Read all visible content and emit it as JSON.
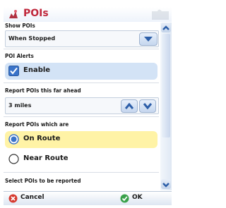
{
  "window": {
    "title": "POIs"
  },
  "show_pois": {
    "label": "Show POIs",
    "value": "When Stopped"
  },
  "poi_alerts": {
    "label": "POI Alerts",
    "checkbox_label": "Enable",
    "checked": true
  },
  "report_ahead": {
    "label": "Report POIs this far ahead",
    "value": "3 miles"
  },
  "report_which": {
    "label": "Report POIs which are",
    "options": [
      {
        "label": "On Route",
        "selected": true
      },
      {
        "label": "Near Route",
        "selected": false
      }
    ]
  },
  "select_pois": {
    "label": "Select POIs to be reported"
  },
  "buttons": {
    "cancel": "Cancel",
    "ok": "OK"
  },
  "colors": {
    "title": "#c0283c",
    "highlight_blue": "#d3e3f6",
    "highlight_yellow": "#fff3a6",
    "accent_blue": "#3a73c9",
    "accent_green": "#3aa14b",
    "cancel_red": "#d63a2f"
  }
}
